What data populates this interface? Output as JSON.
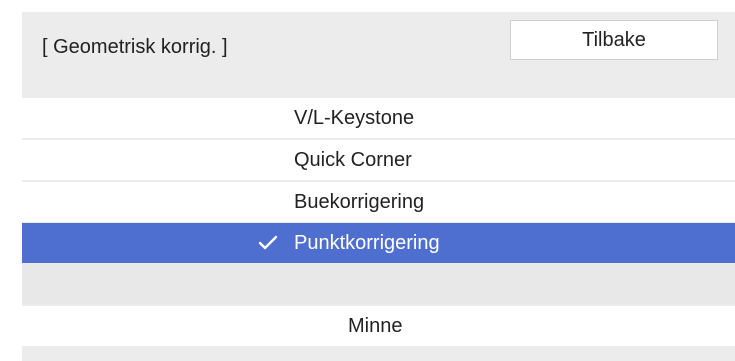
{
  "header": {
    "title": "[ Geometrisk korrig. ]",
    "back_label": "Tilbake"
  },
  "menu": {
    "items": [
      {
        "label": "V/L-Keystone",
        "selected": false
      },
      {
        "label": "Quick Corner",
        "selected": false
      },
      {
        "label": "Buekorrigering",
        "selected": false
      },
      {
        "label": "Punktkorrigering",
        "selected": true
      }
    ],
    "memory_label": "Minne"
  },
  "icons": {
    "selected_marker": "check-icon"
  },
  "colors": {
    "panel_background": "#ececec",
    "item_background": "#ffffff",
    "selected_background": "#4f6fd0",
    "selected_text": "#ffffff",
    "text": "#222222"
  }
}
